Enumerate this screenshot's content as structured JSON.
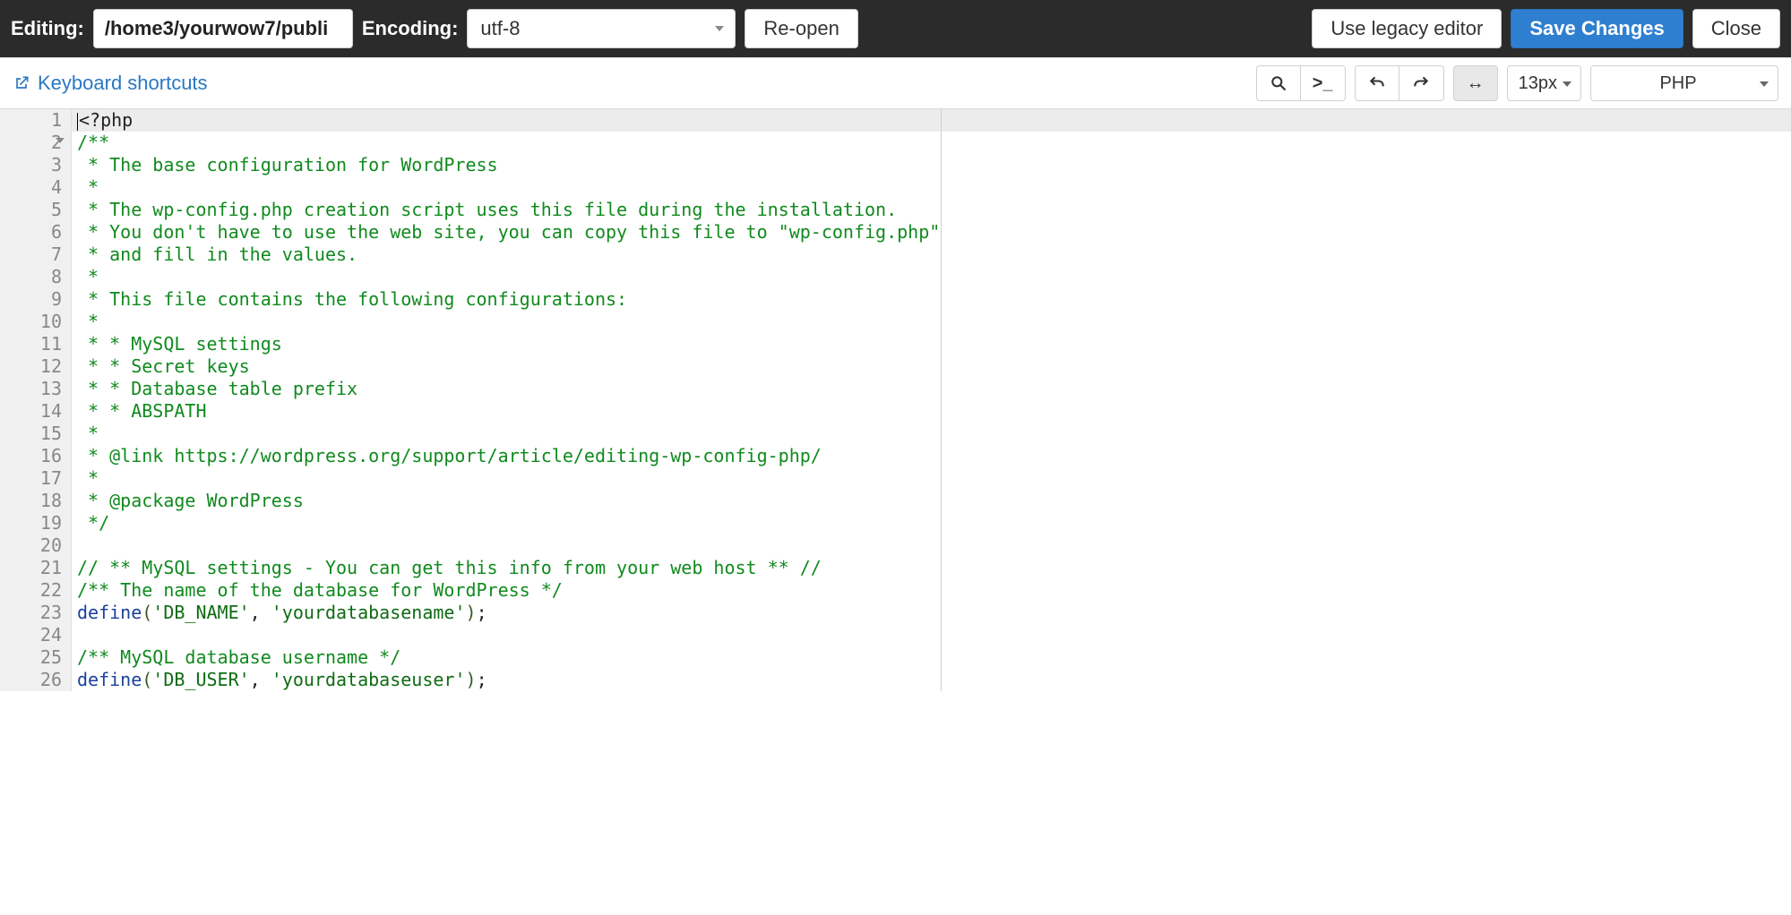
{
  "header": {
    "editing_label": "Editing:",
    "file_path": "/home3/yourwow7/publi",
    "encoding_label": "Encoding:",
    "encoding_value": "utf-8",
    "reopen_label": "Re-open",
    "legacy_label": "Use legacy editor",
    "save_label": "Save Changes",
    "close_label": "Close"
  },
  "toolbar": {
    "keyboard_link": "Keyboard shortcuts",
    "font_size": "13px",
    "language": "PHP"
  },
  "code_lines": [
    {
      "n": 1,
      "current": true,
      "cursor": true,
      "spans": [
        {
          "t": "<?php",
          "c": "tk-open"
        }
      ]
    },
    {
      "n": 2,
      "fold": true,
      "spans": [
        {
          "t": "/**",
          "c": "tk-comment"
        }
      ]
    },
    {
      "n": 3,
      "spans": [
        {
          "t": " * The base configuration for WordPress",
          "c": "tk-comment"
        }
      ]
    },
    {
      "n": 4,
      "spans": [
        {
          "t": " *",
          "c": "tk-comment"
        }
      ]
    },
    {
      "n": 5,
      "spans": [
        {
          "t": " * The wp-config.php creation script uses this file during the installation.",
          "c": "tk-comment"
        }
      ]
    },
    {
      "n": 6,
      "spans": [
        {
          "t": " * You don't have to use the web site, you can copy this file to \"wp-config.php\"",
          "c": "tk-comment"
        }
      ]
    },
    {
      "n": 7,
      "spans": [
        {
          "t": " * and fill in the values.",
          "c": "tk-comment"
        }
      ]
    },
    {
      "n": 8,
      "spans": [
        {
          "t": " *",
          "c": "tk-comment"
        }
      ]
    },
    {
      "n": 9,
      "spans": [
        {
          "t": " * This file contains the following configurations:",
          "c": "tk-comment"
        }
      ]
    },
    {
      "n": 10,
      "spans": [
        {
          "t": " *",
          "c": "tk-comment"
        }
      ]
    },
    {
      "n": 11,
      "spans": [
        {
          "t": " * * MySQL settings",
          "c": "tk-comment"
        }
      ]
    },
    {
      "n": 12,
      "spans": [
        {
          "t": " * * Secret keys",
          "c": "tk-comment"
        }
      ]
    },
    {
      "n": 13,
      "spans": [
        {
          "t": " * * Database table prefix",
          "c": "tk-comment"
        }
      ]
    },
    {
      "n": 14,
      "spans": [
        {
          "t": " * * ABSPATH",
          "c": "tk-comment"
        }
      ]
    },
    {
      "n": 15,
      "spans": [
        {
          "t": " *",
          "c": "tk-comment"
        }
      ]
    },
    {
      "n": 16,
      "spans": [
        {
          "t": " * @link https://wordpress.org/support/article/editing-wp-config-php/",
          "c": "tk-comment"
        }
      ]
    },
    {
      "n": 17,
      "spans": [
        {
          "t": " *",
          "c": "tk-comment"
        }
      ]
    },
    {
      "n": 18,
      "spans": [
        {
          "t": " * @package WordPress",
          "c": "tk-comment"
        }
      ]
    },
    {
      "n": 19,
      "spans": [
        {
          "t": " */",
          "c": "tk-comment"
        }
      ]
    },
    {
      "n": 20,
      "spans": [
        {
          "t": "",
          "c": ""
        }
      ]
    },
    {
      "n": 21,
      "spans": [
        {
          "t": "// ** MySQL settings - You can get this info from your web host ** //",
          "c": "tk-comment"
        }
      ]
    },
    {
      "n": 22,
      "spans": [
        {
          "t": "/** The name of the database for WordPress */",
          "c": "tk-comment"
        }
      ]
    },
    {
      "n": 23,
      "spans": [
        {
          "t": "define",
          "c": "tk-func"
        },
        {
          "t": "(",
          "c": "tk-paren"
        },
        {
          "t": "'DB_NAME'",
          "c": "tk-string"
        },
        {
          "t": ", ",
          "c": ""
        },
        {
          "t": "'yourdatabasename'",
          "c": "tk-string"
        },
        {
          "t": ")",
          "c": "tk-paren"
        },
        {
          "t": ";",
          "c": ""
        }
      ]
    },
    {
      "n": 24,
      "spans": [
        {
          "t": "",
          "c": ""
        }
      ]
    },
    {
      "n": 25,
      "spans": [
        {
          "t": "/** MySQL database username */",
          "c": "tk-comment"
        }
      ]
    },
    {
      "n": 26,
      "spans": [
        {
          "t": "define",
          "c": "tk-func"
        },
        {
          "t": "(",
          "c": "tk-paren"
        },
        {
          "t": "'DB_USER'",
          "c": "tk-string"
        },
        {
          "t": ", ",
          "c": ""
        },
        {
          "t": "'yourdatabaseuser'",
          "c": "tk-string"
        },
        {
          "t": ")",
          "c": "tk-paren"
        },
        {
          "t": ";",
          "c": ""
        }
      ]
    }
  ]
}
